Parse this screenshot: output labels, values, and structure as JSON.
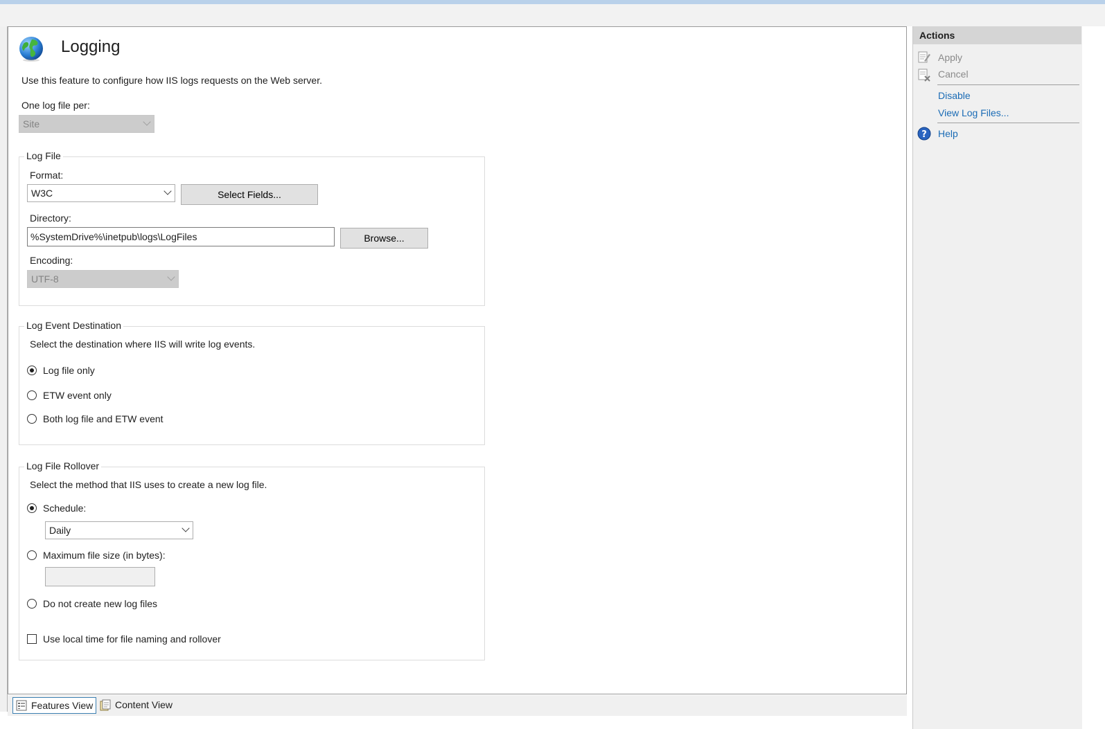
{
  "page": {
    "title": "Logging",
    "description": "Use this feature to configure how IIS logs requests on the Web server."
  },
  "one_log_file_per": {
    "label": "One log file per:",
    "value": "Site"
  },
  "log_file": {
    "legend": "Log File",
    "format_label": "Format:",
    "format_value": "W3C",
    "select_fields_label": "Select Fields...",
    "directory_label": "Directory:",
    "directory_value": "%SystemDrive%\\inetpub\\logs\\LogFiles",
    "browse_label": "Browse...",
    "encoding_label": "Encoding:",
    "encoding_value": "UTF-8"
  },
  "log_event_destination": {
    "legend": "Log Event Destination",
    "description": "Select the destination where IIS will write log events.",
    "options": [
      "Log file only",
      "ETW event only",
      "Both log file and ETW event"
    ],
    "selected": "Log file only"
  },
  "log_file_rollover": {
    "legend": "Log File Rollover",
    "description": "Select the method that IIS uses to create a new log file.",
    "schedule_label": "Schedule:",
    "schedule_value": "Daily",
    "max_size_label": "Maximum file size (in bytes):",
    "max_size_value": "",
    "no_new_label": "Do not create new log files",
    "local_time_label": "Use local time for file naming and rollover",
    "selected": "Schedule:",
    "local_time_checked": false
  },
  "actions": {
    "header": "Actions",
    "items": [
      {
        "label": "Apply",
        "enabled": false,
        "icon": "apply-icon"
      },
      {
        "label": "Cancel",
        "enabled": false,
        "icon": "cancel-icon"
      },
      {
        "label": "Disable",
        "enabled": true
      },
      {
        "label": "View Log Files...",
        "enabled": true
      },
      {
        "label": "Help",
        "enabled": true,
        "icon": "help-icon"
      }
    ]
  },
  "view_tabs": {
    "features": "Features View",
    "content": "Content View",
    "active": "Features View"
  },
  "colors": {
    "link": "#1a6bb5",
    "active_tab_border": "#3c7fb1",
    "actions_header": "#d5d5d5"
  }
}
